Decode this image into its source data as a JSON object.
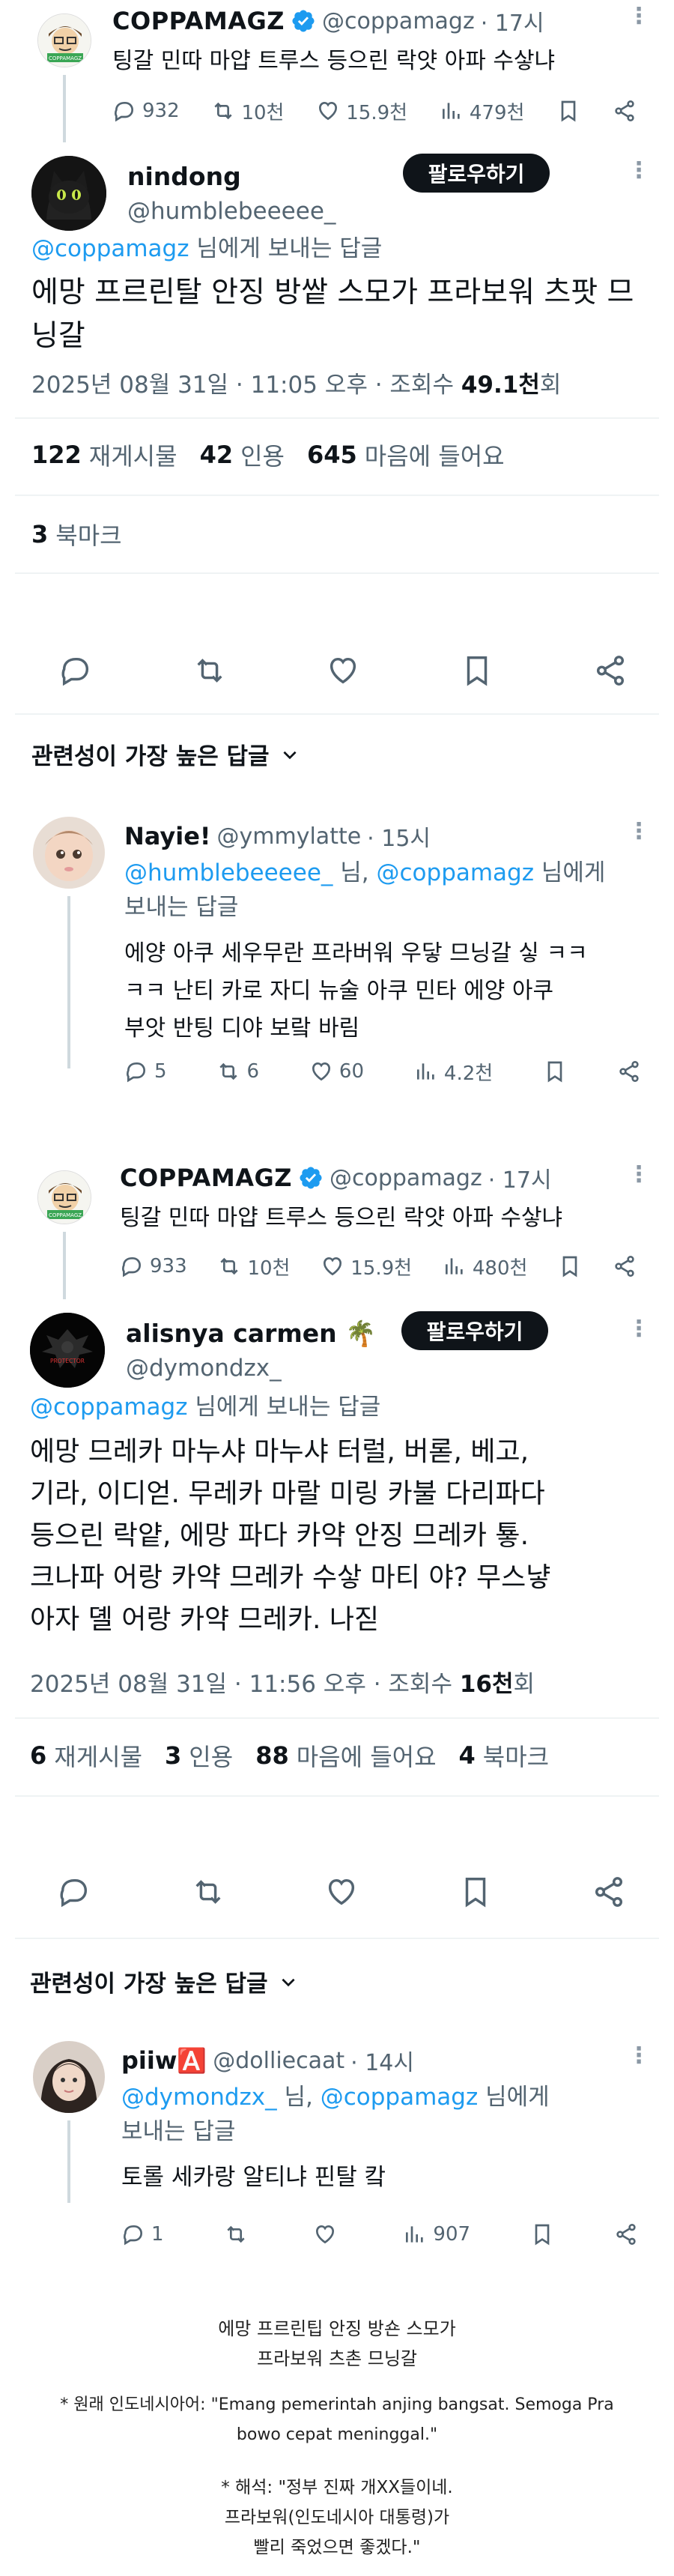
{
  "tweet1": {
    "display_name": "COPPAMAGZ",
    "handle": "@coppamagz",
    "time": "· 17시",
    "text": "팅갈 민따 마얍 트루스 등으린 락얏 아파 수샇냐",
    "stats": {
      "replies": "932",
      "retweets": "10천",
      "likes": "15.9천",
      "views": "479천"
    }
  },
  "reply1": {
    "display_name": "nindong",
    "handle": "@humblebeeeee_",
    "follow_label": "팔로우하기",
    "reply_to_user": "@coppamagz",
    "reply_to_suffix": " 님에게 보내는 답글",
    "text": "에망 프르린탈 안징 방쌑 스모가 프라보워 츠팟 므닝갈",
    "meta_prefix": "2025년 08월 31일 · 11:05 오후 · 조회수 ",
    "views": "49.1천",
    "views_suffix": "회",
    "counts": {
      "reposts_num": "122",
      "reposts_label": "재게시물",
      "quotes_num": "42",
      "quotes_label": "인용",
      "likes_num": "645",
      "likes_label": "마음에 들어요",
      "bookmarks_num": "3",
      "bookmarks_label": "북마크"
    }
  },
  "relevant_label_1": "관련성이 가장 높은 답글",
  "nested1": {
    "display_name": "Nayie!",
    "handle": "@ymmylatte",
    "time": "· 15시",
    "reply_to_line1_a": "@humblebeeeee_",
    "reply_to_line1_b": " 님, ",
    "reply_to_line1_c": "@coppamagz",
    "reply_to_line1_d": " 님에게",
    "reply_to_line2": "보내는 답글",
    "text_lines": [
      "에양 아쿠 세우무란 프라버워 우닿 므닝갈 싷 ㅋㅋ",
      "ㅋㅋ 난티 카로 자디 뉴술 아쿠 민타 에양 아쿠",
      "부앗 반팅 디야 보랔 바림"
    ],
    "stats": {
      "replies": "5",
      "retweets": "6",
      "likes": "60",
      "views": "4.2천"
    }
  },
  "tweet2": {
    "display_name": "COPPAMAGZ",
    "handle": "@coppamagz",
    "time": "· 17시",
    "text": "팅갈 민따 마얍 트루스 등으린 락얏 아파 수샇냐",
    "stats": {
      "replies": "933",
      "retweets": "10천",
      "likes": "15.9천",
      "views": "480천"
    }
  },
  "reply2": {
    "display_name": "alisnya carmen 🌴",
    "handle": "@dymondzx_",
    "follow_label": "팔로우하기",
    "avatar_text": "PROTECTOR",
    "reply_to_user": "@coppamagz",
    "reply_to_suffix": " 님에게 보내는 답글",
    "text_lines": [
      "에망 므레카 마누샤 마누샤 터럴, 버롣, 베고,",
      "기라, 이디얻. 무레카 마랄 미링 카불 다리파다",
      "등으린 락얕, 에망 파다 카약 안징 므레카 툫.",
      "크나파 어랑 카약 므레카 수샇 마티 야? 무스냫",
      "아자 뎰 어랑 카약 므레카. 나짇"
    ],
    "meta_prefix": "2025년 08월 31일 · 11:56 오후 · 조회수 ",
    "views": "16천",
    "views_suffix": "회",
    "counts": {
      "reposts_num": "6",
      "reposts_label": "재게시물",
      "quotes_num": "3",
      "quotes_label": "인용",
      "likes_num": "88",
      "likes_label": "마음에 들어요",
      "bookmarks_num": "4",
      "bookmarks_label": "북마크"
    }
  },
  "relevant_label_2": "관련성이 가장 높은 답글",
  "nested2": {
    "display_name": "piiw🅰️",
    "handle": "@dolliecaat",
    "time": "· 14시",
    "reply_to_line1_a": "@dymondzx_",
    "reply_to_line1_b": " 님, ",
    "reply_to_line1_c": "@coppamagz",
    "reply_to_line1_d": " 님에게",
    "reply_to_line2": "보내는 답글",
    "text": "토롤 세카랑 알티냐 핀탈 캌",
    "stats": {
      "replies": "1",
      "retweets": "",
      "likes": "",
      "views": "907"
    }
  },
  "footer": {
    "line1": "에망 프르린팁 안징 방숀 스모가",
    "line2": "프라보워 츠촌 므닝갈",
    "original_label": "* 원래 인도네시아어: \"Emang pemerintah anjing bangsat. Semoga Pra",
    "original_label_2": "bowo cepat meninggal.\"",
    "interp_1": "* 해석: \"정부 진짜 개XX들이네.",
    "interp_2": "프라보워(인도네시아 대통령)가",
    "interp_3": "빨리 죽었으면 좋겠다.\""
  },
  "colors": {
    "link": "#1d9bf0",
    "text": "#0f1419",
    "muted": "#536471",
    "button": "#0f1419",
    "verified": "#1d9bf0"
  }
}
